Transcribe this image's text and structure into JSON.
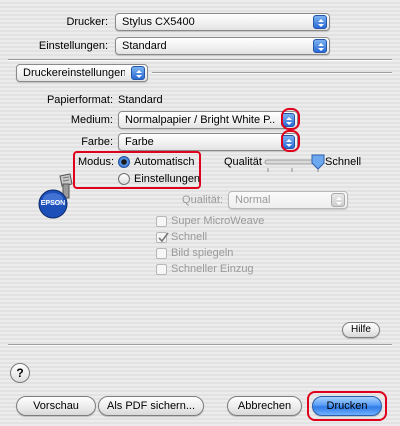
{
  "printer": {
    "label": "Drucker:",
    "value": "Stylus CX5400"
  },
  "settings": {
    "label": "Einstellungen:",
    "value": "Standard"
  },
  "pane": {
    "value": "Druckereinstellungen"
  },
  "paper_format": {
    "label": "Papierformat:",
    "value": "Standard"
  },
  "medium": {
    "label": "Medium:",
    "value": "Normalpapier / Bright White P..."
  },
  "color": {
    "label": "Farbe:",
    "value": "Farbe"
  },
  "mode": {
    "label": "Modus:",
    "options": [
      "Automatisch",
      "Einstellungen"
    ],
    "selected": "Automatisch"
  },
  "quality_slider": {
    "label": "Qualität",
    "end_label": "Schnell",
    "level": 1.0
  },
  "quality_popup": {
    "label": "Qualität:",
    "value": "Normal"
  },
  "options": [
    {
      "label": "Super MicroWeave",
      "checked": false
    },
    {
      "label": "Schnell",
      "checked": true
    },
    {
      "label": "Bild spiegeln",
      "checked": false
    },
    {
      "label": "Schneller Einzug",
      "checked": false
    }
  ],
  "brand": {
    "logo_text": "EPSON"
  },
  "buttons": {
    "help": "Hilfe",
    "question": "?",
    "preview": "Vorschau",
    "save_pdf": "Als PDF sichern...",
    "cancel": "Abbrechen",
    "print": "Drucken"
  },
  "colors": {
    "highlight": "#e0001b",
    "accent": "#2f7ce6"
  }
}
